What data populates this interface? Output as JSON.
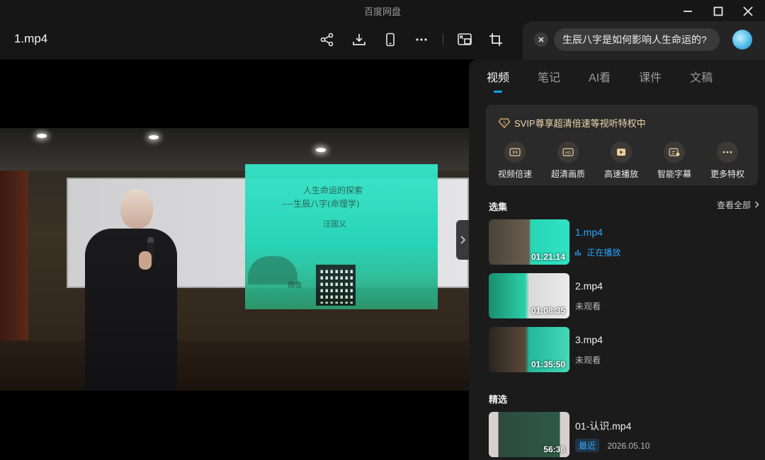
{
  "window": {
    "app_title": "百度网盘"
  },
  "toolbar": {
    "file_title": "1.mp4"
  },
  "ask": {
    "question": "生辰八字是如何影响人生命运的?"
  },
  "video_slide": {
    "title_line1": "人生命运的探索",
    "title_line2": "----生辰八字(命理学)",
    "author": "汪国义",
    "wechat_label": "微信"
  },
  "panel": {
    "tabs": [
      "视频",
      "笔记",
      "AI看",
      "课件",
      "文稿"
    ],
    "active_tab": 0,
    "svip": {
      "headline": "SVIP尊享超清倍速等视听特权中",
      "badge": "S",
      "features": [
        {
          "label": "视频倍速",
          "icon": "speed-icon"
        },
        {
          "label": "超清画质",
          "icon": "hd-icon"
        },
        {
          "label": "高速播放",
          "icon": "fast-play-icon"
        },
        {
          "label": "智能字幕",
          "icon": "subtitle-icon"
        },
        {
          "label": "更多特权",
          "icon": "more-icon"
        }
      ]
    },
    "playlist": {
      "title": "选集",
      "see_all": "查看全部",
      "items": [
        {
          "name": "1.mp4",
          "duration": "01:21:14",
          "status": "正在播放",
          "playing": true
        },
        {
          "name": "2.mp4",
          "duration": "01:08:35",
          "status": "未观看",
          "playing": false
        },
        {
          "name": "3.mp4",
          "duration": "01:35:50",
          "status": "未观看",
          "playing": false
        }
      ]
    },
    "featured": {
      "title": "精选",
      "items": [
        {
          "name": "01-认识.mp4",
          "duration": "56:36",
          "tag": "最近",
          "date": "2026.05.10"
        }
      ]
    }
  },
  "colors": {
    "accent": "#06a7ff",
    "svip_gold": "#f0d9b0",
    "panel_bg": "#1b1b1b"
  }
}
